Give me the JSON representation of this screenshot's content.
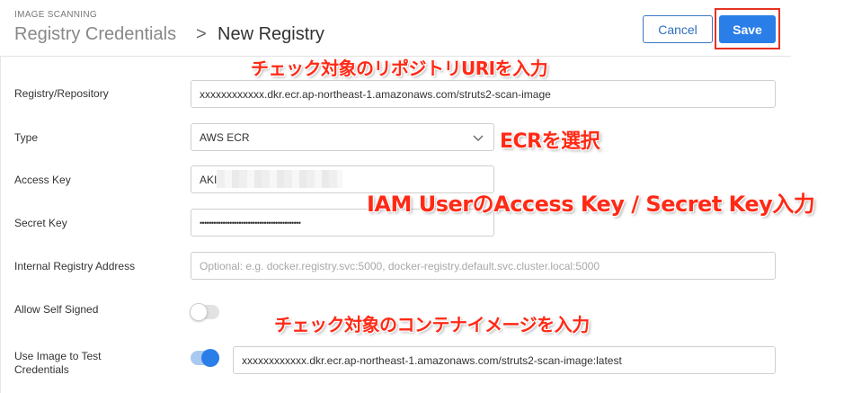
{
  "header": {
    "section_label": "IMAGE SCANNING",
    "breadcrumb_parent": "Registry Credentials",
    "breadcrumb_separator": ">",
    "page_title": "New Registry",
    "cancel_label": "Cancel",
    "save_label": "Save"
  },
  "form": {
    "registry": {
      "label": "Registry/Repository",
      "value": "xxxxxxxxxxxx.dkr.ecr.ap-northeast-1.amazonaws.com/struts2-scan-image"
    },
    "type": {
      "label": "Type",
      "selected": "AWS ECR"
    },
    "access_key": {
      "label": "Access Key",
      "value": "AKI"
    },
    "secret_key": {
      "label": "Secret Key",
      "value": "••••••••••••••••••••••••••••••••••••••••••••"
    },
    "internal_address": {
      "label": "Internal Registry Address",
      "placeholder": "Optional: e.g. docker.registry.svc:5000, docker-registry.default.svc.cluster.local:5000"
    },
    "allow_self_signed": {
      "label": "Allow Self Signed",
      "enabled": false
    },
    "use_image": {
      "label_line1": "Use Image to Test",
      "label_line2": "Credentials",
      "enabled": true,
      "value": "xxxxxxxxxxxx.dkr.ecr.ap-northeast-1.amazonaws.com/struts2-scan-image:latest"
    }
  },
  "annotations": {
    "repo_uri": "チェック対象のリポジトリURIを入力",
    "ecr_select": "ECRを選択",
    "keys": "IAM UserのAccess Key / Secret Key入力",
    "container_image": "チェック対象のコンテナイメージを入力"
  },
  "colors": {
    "primary": "#2a7ee8",
    "highlight_frame": "#e53223",
    "annotation": "#ff2a16"
  },
  "icons": {
    "type_select": "chevron-down-icon"
  }
}
